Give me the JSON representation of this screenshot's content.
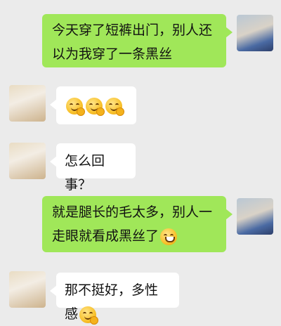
{
  "messages": [
    {
      "side": "right",
      "avatar": "user-avatar-boy",
      "text": "今天穿了短裤出门，别人还以为我穿了一条黑丝"
    },
    {
      "side": "left",
      "avatar": "contact-avatar-cat",
      "emojis": [
        "thinking-hand-emoji",
        "thinking-hand-emoji",
        "thinking-hand-emoji"
      ]
    },
    {
      "side": "left",
      "avatar": "contact-avatar-cat",
      "text": "怎么回事？"
    },
    {
      "side": "right",
      "avatar": "user-avatar-boy",
      "text": "就是腿长的毛太多，别人一走眼就看成黑丝了",
      "trailing_emoji": "grinning-emoji"
    },
    {
      "side": "left",
      "avatar": "contact-avatar-cat",
      "text": "那不挺好，多性感",
      "trailing_emoji": "thinking-hand-emoji"
    }
  ],
  "colors": {
    "background": "#ebebeb",
    "self_bubble": "#a0e759",
    "other_bubble": "#ffffff"
  }
}
